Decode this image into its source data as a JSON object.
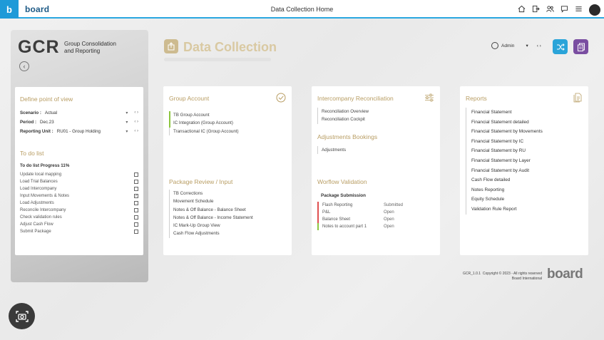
{
  "topbar": {
    "logo_letter": "b",
    "brand": "board",
    "title": "Data Collection Home",
    "icons": [
      "home-icon",
      "exit-icon",
      "users-icon",
      "chat-icon",
      "menu-icon"
    ]
  },
  "left_panel": {
    "gcr": "GCR",
    "gcr_sub_line1": "Group Consolidation",
    "gcr_sub_line2": "and Reporting",
    "pov": {
      "title": "Define point of view",
      "rows": [
        {
          "label": "Scenario :",
          "value": "Actual"
        },
        {
          "label": "Period :",
          "value": "Dec.23"
        },
        {
          "label": "Reporting Unit :",
          "value": "RU01 - Group Holding"
        }
      ],
      "dropdown_glyph": "▾",
      "nav_glyph": "‹ ›"
    },
    "todo": {
      "title": "To do list",
      "progress": "To do list Progress 11%",
      "items": [
        {
          "label": "Update local mapping",
          "checked": ""
        },
        {
          "label": "Load Trial Balances",
          "checked": ""
        },
        {
          "label": "Load Intercompany",
          "checked": ""
        },
        {
          "label": "Input Movements & Notes",
          "checked": "✓"
        },
        {
          "label": "Load Adjustments",
          "checked": ""
        },
        {
          "label": "Reconcile Intercompany",
          "checked": ""
        },
        {
          "label": "Check validation rules",
          "checked": ""
        },
        {
          "label": "Adjust Cash Flow",
          "checked": ""
        },
        {
          "label": "Submit Package",
          "checked": ""
        }
      ]
    }
  },
  "header": {
    "title": "Data Collection",
    "user": "Admin",
    "user_dropdown": "▾",
    "nav": "‹ ›"
  },
  "group_account": {
    "title": "Group Account",
    "links": [
      "TB Group Account",
      "IC Integration (Group Account)",
      "Transactional IC (Group Account)"
    ],
    "package_title": "Package Review / Input",
    "package_links": [
      "TB Corrections",
      "Movement Schedule",
      "Notes & Off Balance - Balance Sheet",
      "Notes & Off Balance - Income Statement",
      "IC Mark-Up Group View",
      "Cash Flow Adjustments"
    ]
  },
  "intercompany": {
    "title": "Intercompany Reconciliation",
    "links": [
      "Reconciliation Overview",
      "Reconciliation Cockpit"
    ],
    "adj_title": "Adjustments Bookings",
    "adj_links": [
      "Adjustments"
    ],
    "wf_title": "Worflow Validation",
    "wf_head": "Package Submission",
    "wf_rows": [
      {
        "name": "Flash Reporting",
        "status": "Submitted",
        "color": "#e05050"
      },
      {
        "name": "P&L",
        "status": "Open",
        "color": "#e05050"
      },
      {
        "name": "Balance Sheet",
        "status": "Open",
        "color": "#e05050"
      },
      {
        "name": "Notes to account part 1",
        "status": "Open",
        "color": "#8dc63f"
      }
    ]
  },
  "reports": {
    "title": "Reports",
    "links": [
      "Financial Statement",
      "Financial Statement detailed",
      "Financial Statement by Movements",
      "Financial Statement by IC",
      "Financial Statement by RU",
      "Financial Statement by Layer",
      "Financial Statement by Audit",
      "Cash Flow detailed",
      "Notes Reporting",
      "Equity Schedule",
      "Validation Rule Report"
    ]
  },
  "footer": {
    "version": "GCR_1.0.1",
    "copyright": "Copyright © 2023 - All rights reserved",
    "company": "Board International",
    "logo": "board"
  },
  "colors": {
    "accent_gold": "#b89d63",
    "topbar_line": "#2aa7e0",
    "shuffle_btn": "#2aa4d9",
    "docs_btn": "#7a4ea1"
  }
}
